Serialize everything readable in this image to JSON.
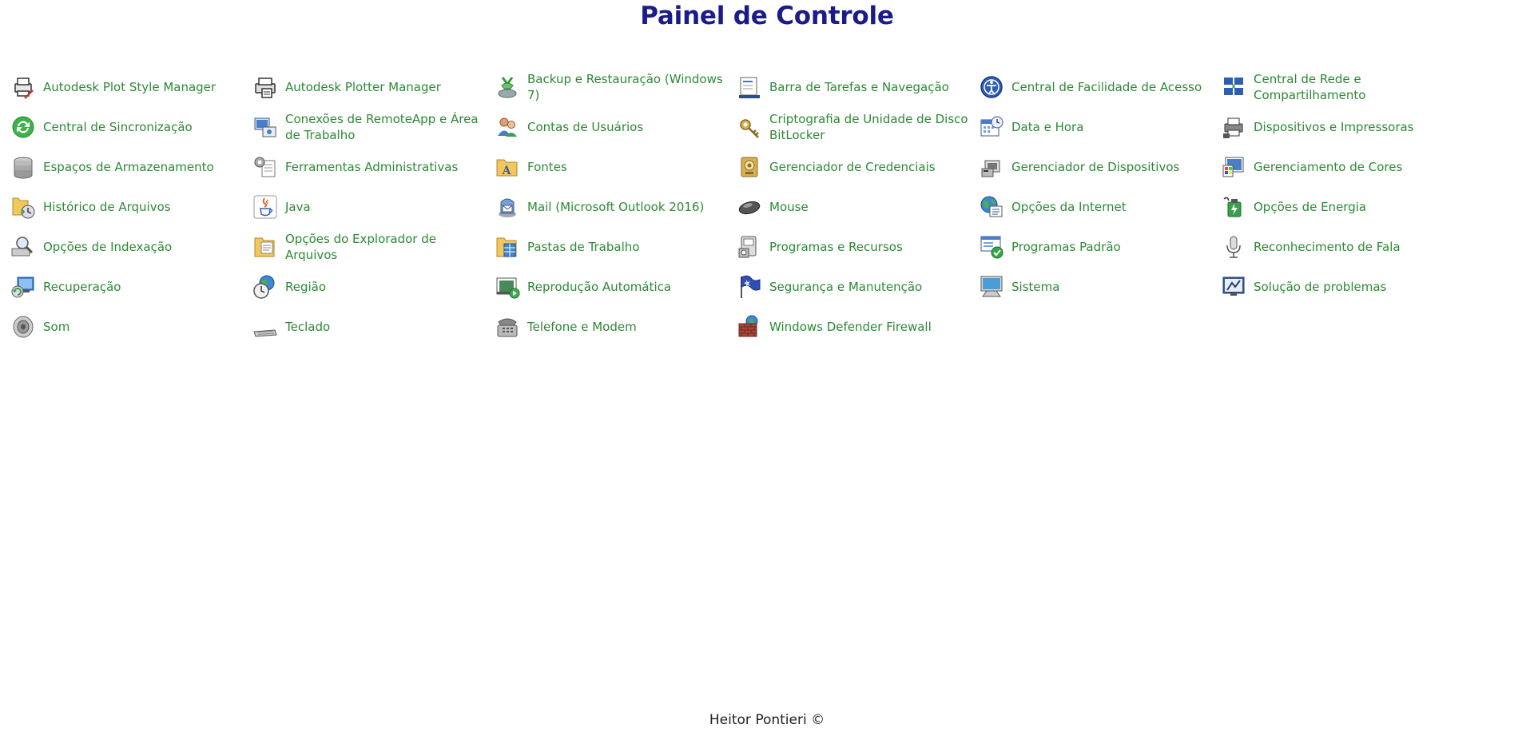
{
  "page": {
    "title": "Painel de Controle",
    "footer": "Heitor Pontieri ©"
  },
  "colors": {
    "title": "#1b1b8a",
    "link": "#2b8a33",
    "footer": "#222222",
    "background": "#ffffff"
  },
  "items": [
    {
      "label": "Autodesk Plot Style Manager",
      "icon": "printer-pencil-icon"
    },
    {
      "label": "Autodesk Plotter Manager",
      "icon": "plotter-icon"
    },
    {
      "label": "Backup e Restauração (Windows 7)",
      "icon": "backup-restore-icon"
    },
    {
      "label": "Barra de Tarefas e Navegação",
      "icon": "taskbar-icon"
    },
    {
      "label": "Central de Facilidade de Acesso",
      "icon": "ease-of-access-icon"
    },
    {
      "label": "Central de Rede e Compartilhamento",
      "icon": "network-center-icon"
    },
    {
      "label": "Central de Sincronização",
      "icon": "sync-center-icon"
    },
    {
      "label": "Conexões de RemoteApp e Área de Trabalho",
      "icon": "remoteapp-icon"
    },
    {
      "label": "Contas de Usuários",
      "icon": "user-accounts-icon"
    },
    {
      "label": "Criptografia de Unidade de Disco BitLocker",
      "icon": "bitlocker-icon"
    },
    {
      "label": "Data e Hora",
      "icon": "calendar-clock-icon"
    },
    {
      "label": "Dispositivos e Impressoras",
      "icon": "devices-printers-icon"
    },
    {
      "label": "Espaços de Armazenamento",
      "icon": "storage-spaces-icon"
    },
    {
      "label": "Ferramentas Administrativas",
      "icon": "admin-tools-icon"
    },
    {
      "label": "Fontes",
      "icon": "fonts-folder-icon"
    },
    {
      "label": "Gerenciador de Credenciais",
      "icon": "credential-manager-icon"
    },
    {
      "label": "Gerenciador de Dispositivos",
      "icon": "device-manager-icon"
    },
    {
      "label": "Gerenciamento de Cores",
      "icon": "color-management-icon"
    },
    {
      "label": "Histórico de Arquivos",
      "icon": "file-history-icon"
    },
    {
      "label": "Java",
      "icon": "java-icon"
    },
    {
      "label": "Mail (Microsoft Outlook 2016)",
      "icon": "mail-icon"
    },
    {
      "label": "Mouse",
      "icon": "mouse-icon"
    },
    {
      "label": "Opções da Internet",
      "icon": "internet-options-icon"
    },
    {
      "label": "Opções de Energia",
      "icon": "power-options-icon"
    },
    {
      "label": "Opções de Indexação",
      "icon": "indexing-options-icon"
    },
    {
      "label": "Opções do Explorador de Arquivos",
      "icon": "explorer-options-icon"
    },
    {
      "label": "Pastas de Trabalho",
      "icon": "work-folders-icon"
    },
    {
      "label": "Programas e Recursos",
      "icon": "programs-features-icon"
    },
    {
      "label": "Programas Padrão",
      "icon": "default-programs-icon"
    },
    {
      "label": "Reconhecimento de Fala",
      "icon": "microphone-icon"
    },
    {
      "label": "Recuperação",
      "icon": "recovery-icon"
    },
    {
      "label": "Região",
      "icon": "region-globe-clock-icon"
    },
    {
      "label": "Reprodução Automática",
      "icon": "autoplay-icon"
    },
    {
      "label": "Segurança e Manutenção",
      "icon": "security-flag-icon"
    },
    {
      "label": "Sistema",
      "icon": "system-computer-icon"
    },
    {
      "label": "Solução de problemas",
      "icon": "troubleshooting-icon"
    },
    {
      "label": "Som",
      "icon": "speaker-icon"
    },
    {
      "label": "Teclado",
      "icon": "keyboard-icon"
    },
    {
      "label": "Telefone e Modem",
      "icon": "phone-modem-icon"
    },
    {
      "label": "Windows Defender Firewall",
      "icon": "firewall-icon"
    }
  ]
}
